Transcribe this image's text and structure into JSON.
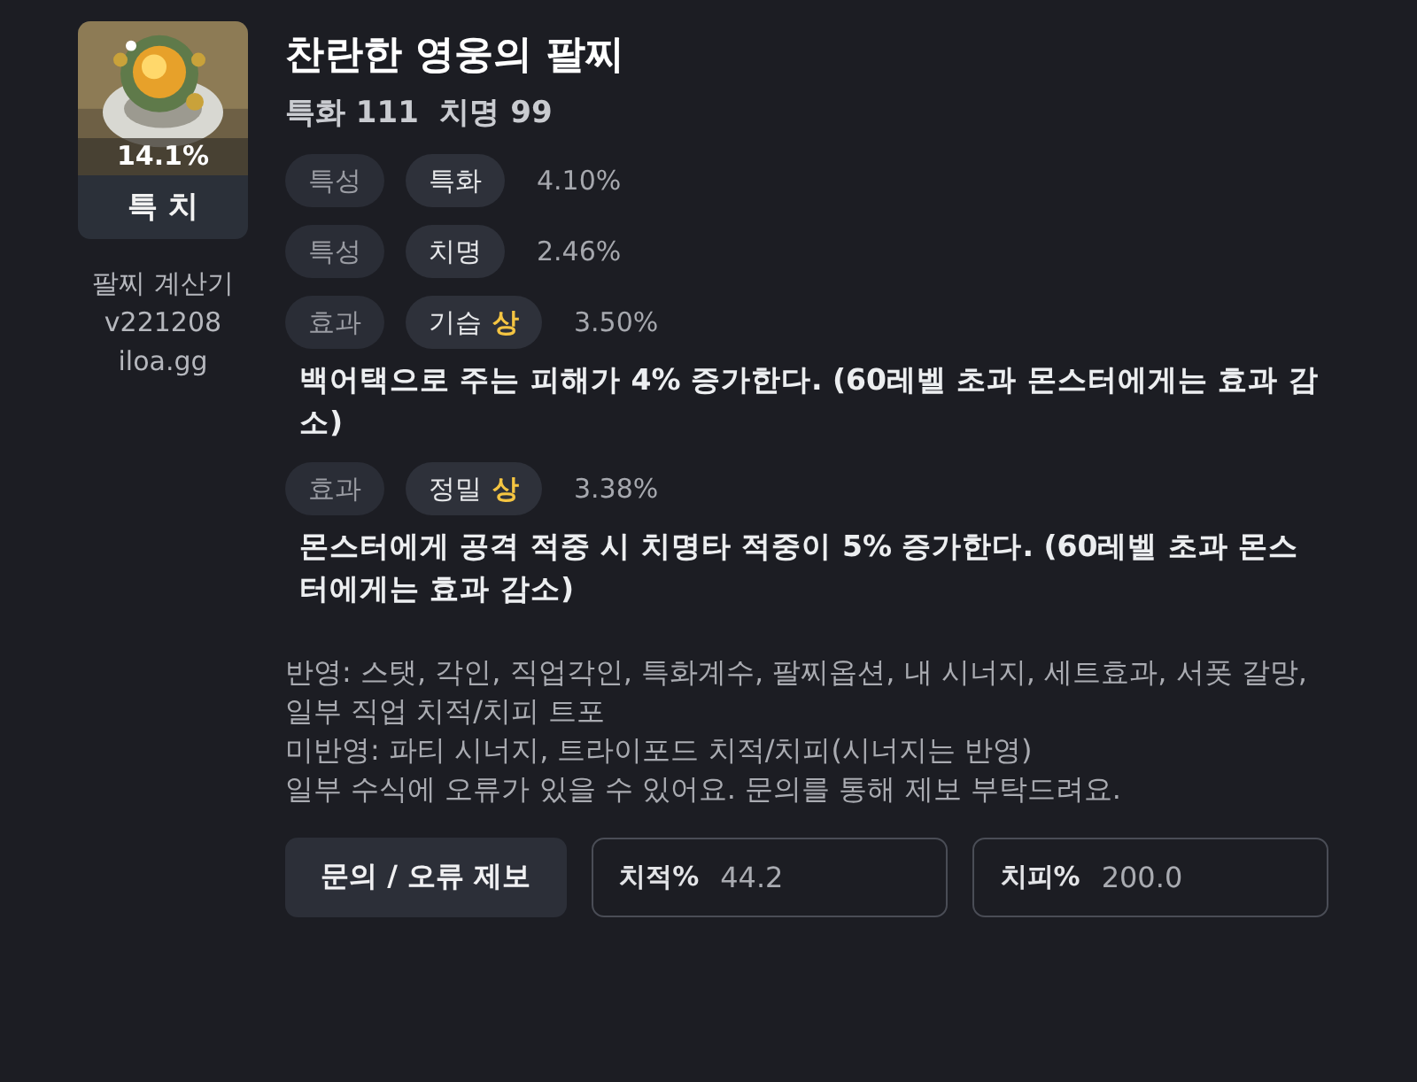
{
  "item": {
    "percent": "14.1%",
    "tag": "특 치"
  },
  "app_info": [
    "팔찌 계산기",
    "v221208",
    "iloa.gg"
  ],
  "title": "찬란한 영웅의 팔찌",
  "subtitle": "특화 111  치명 99",
  "options": [
    {
      "kind": "stat",
      "category": "특성",
      "name": "특화",
      "value": "4.10%"
    },
    {
      "kind": "stat",
      "category": "특성",
      "name": "치명",
      "value": "2.46%"
    },
    {
      "kind": "effect",
      "category": "효과",
      "name": "기습",
      "grade": "상",
      "value": "3.50%",
      "description": "백어택으로 주는 피해가 4% 증가한다. (60레벨 초과 몬스터에게는 효과 감소)"
    },
    {
      "kind": "effect",
      "category": "효과",
      "name": "정밀",
      "grade": "상",
      "value": "3.38%",
      "description": "몬스터에게 공격 적중 시 치명타 적중이 5% 증가한다. (60레벨 초과 몬스터에게는 효과 감소)"
    }
  ],
  "notes": [
    "반영: 스탯, 각인, 직업각인, 특화계수, 팔찌옵션, 내 시너지, 세트효과, 서폿 갈망, 일부 직업 치적/치피 트포",
    "미반영: 파티 시너지, 트라이포드 치적/치피(시너지는 반영)",
    "일부 수식에 오류가 있을 수 있어요. 문의를 통해 제보 부탁드려요."
  ],
  "report_button": "문의 / 오류 제보",
  "fields": [
    {
      "label": "치적%",
      "value": "44.2"
    },
    {
      "label": "치피%",
      "value": "200.0"
    }
  ]
}
